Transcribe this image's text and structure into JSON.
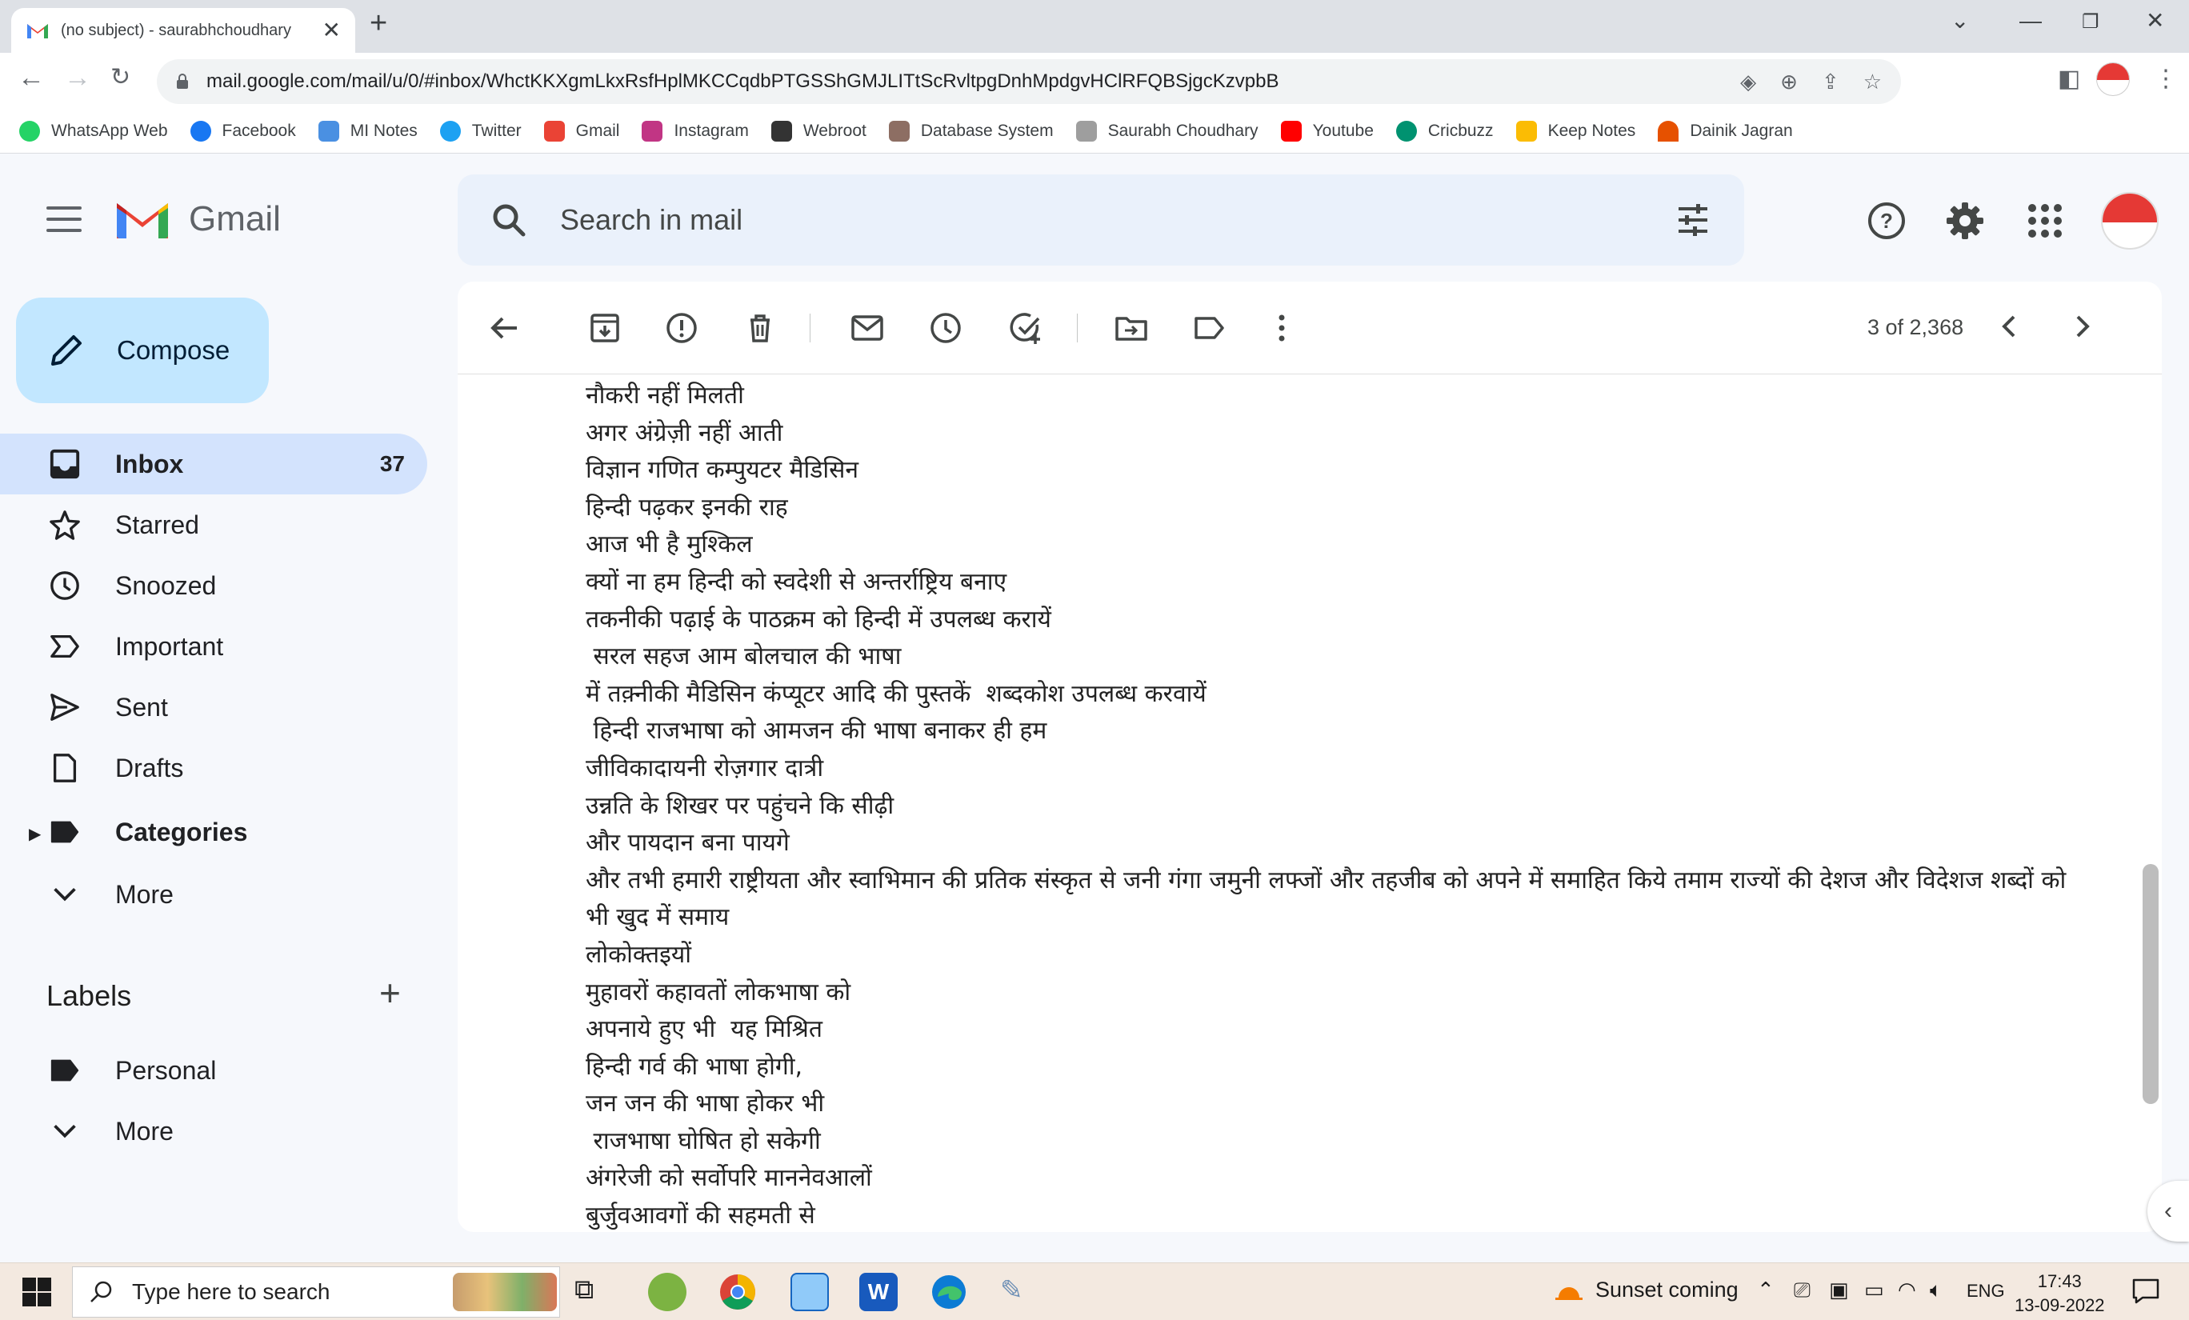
{
  "browser": {
    "tab_title": "(no subject) - saurabhchoudhary",
    "url": "mail.google.com/mail/u/0/#inbox/WhctKKXgmLkxRsfHplMKCCqdbPTGSShGMJLITtScRvltpgDnhMpdgvHClRFQBSjgcKzvpbB",
    "bookmarks": [
      {
        "label": "WhatsApp Web",
        "color": "#25d366"
      },
      {
        "label": "Facebook",
        "color": "#1877f2"
      },
      {
        "label": "MI Notes",
        "color": "#4a90e2"
      },
      {
        "label": "Twitter",
        "color": "#1da1f2"
      },
      {
        "label": "Gmail",
        "color": "#ea4335"
      },
      {
        "label": "Instagram",
        "color": "#c13584"
      },
      {
        "label": "Webroot",
        "color": "#333333"
      },
      {
        "label": "Database System",
        "color": "#8d6e63"
      },
      {
        "label": "Saurabh Choudhary",
        "color": "#9e9e9e"
      },
      {
        "label": "Youtube",
        "color": "#ff0000"
      },
      {
        "label": "Cricbuzz",
        "color": "#009270"
      },
      {
        "label": "Keep Notes",
        "color": "#fbbc04"
      },
      {
        "label": "Dainik Jagran",
        "color": "#e65100"
      }
    ]
  },
  "gmail": {
    "logo_text": "Gmail",
    "search_placeholder": "Search in mail",
    "compose_label": "Compose",
    "nav": [
      {
        "label": "Inbox",
        "count": "37",
        "icon": "inbox-icon"
      },
      {
        "label": "Starred",
        "count": "",
        "icon": "star-icon"
      },
      {
        "label": "Snoozed",
        "count": "",
        "icon": "clock-icon"
      },
      {
        "label": "Important",
        "count": "",
        "icon": "important-icon"
      },
      {
        "label": "Sent",
        "count": "",
        "icon": "send-icon"
      },
      {
        "label": "Drafts",
        "count": "",
        "icon": "draft-icon"
      },
      {
        "label": "Categories",
        "count": "",
        "icon": "label-icon"
      },
      {
        "label": "More",
        "count": "",
        "icon": "chevron-down-icon"
      }
    ],
    "labels_title": "Labels",
    "labels": [
      {
        "label": "Personal",
        "icon": "label-icon"
      },
      {
        "label": "More",
        "icon": "chevron-down-icon"
      }
    ],
    "pager": "3 of 2,368",
    "message_lines": [
      "नौकरी नहीं मिलती",
      "अगर अंग्रेज़ी नहीं आती",
      "विज्ञान गणित कम्पुयटर मैडिसिन",
      "हिन्दी पढ़कर इनकी राह",
      "आज भी है मुश्किल",
      "क्यों ना हम हिन्दी को स्वदेशी से अन्तर्राष्ट्रिय बनाए",
      "तकनीकी पढ़ाई के पाठक्रम को हिन्दी में उपलब्ध करायें",
      " सरल सहज आम बोलचाल की भाषा",
      "में तक़्नीकी मैडिसिन कंप्यूटर आदि की पुस्तकें  शब्दकोश उपलब्ध करवायें",
      " हिन्दी राजभाषा को आमजन की भाषा बनाकर ही हम",
      "जीविकादायनी रोज़गार दात्री",
      "उन्नति के शिखर पर पहुंचने कि सीढ़ी",
      "और पायदान बना पायगे",
      "और तभी हमारी राष्ट्रीयता और स्वाभिमान की प्रतिक संस्कृत से जनी गंगा जमुनी लफ्जों और तहजीब को अपने में समाहित किये तमाम राज्यों की देशज और विदेशज शब्दों को",
      "भी खुद में समाय",
      "लोकोक्तइयों",
      "मुहावरों कहावतों लोकभाषा को",
      "अपनाये हुए भी  यह मिश्रित",
      "हिन्दी गर्व की भाषा होगी,",
      "जन जन की भाषा होकर भी",
      " राजभाषा घोषित हो सकेगी",
      "अंगरेजी को सर्वोपरि माननेवआलों",
      "बुर्जुवआवगों की सहमती से"
    ]
  },
  "taskbar": {
    "search_placeholder": "Type here to search",
    "weather": "Sunset coming",
    "lang": "ENG",
    "time": "17:43",
    "date": "13-09-2022"
  }
}
